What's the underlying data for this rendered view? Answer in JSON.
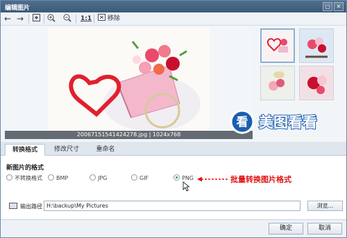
{
  "window": {
    "title": "编辑图片"
  },
  "toolbar": {
    "zoom_ratio": "1:1",
    "delete_label": "移除"
  },
  "image": {
    "caption": "20067151541424278.jpg | 1024x768"
  },
  "logo": {
    "text": "美图看看"
  },
  "tabs": [
    {
      "label": "转换格式"
    },
    {
      "label": "修改尺寸"
    },
    {
      "label": "重命名"
    }
  ],
  "format": {
    "section_title": "新图片的格式",
    "options": [
      {
        "label": "不转换格式",
        "selected": false
      },
      {
        "label": "BMP",
        "selected": false
      },
      {
        "label": "JPG",
        "selected": false
      },
      {
        "label": "GIF",
        "selected": false
      },
      {
        "label": "PNG",
        "selected": true
      }
    ],
    "annotation": "批量转换图片格式"
  },
  "output": {
    "label": "输出路径",
    "path": "H:\\backup\\My Pictures",
    "browse_label": "浏览..."
  },
  "footer": {
    "ok_label": "确定",
    "cancel_label": "取消"
  },
  "colors": {
    "annotation": "#e01414",
    "selected_radio": "#2e9a3a",
    "titlebar": "#3b5a78"
  }
}
